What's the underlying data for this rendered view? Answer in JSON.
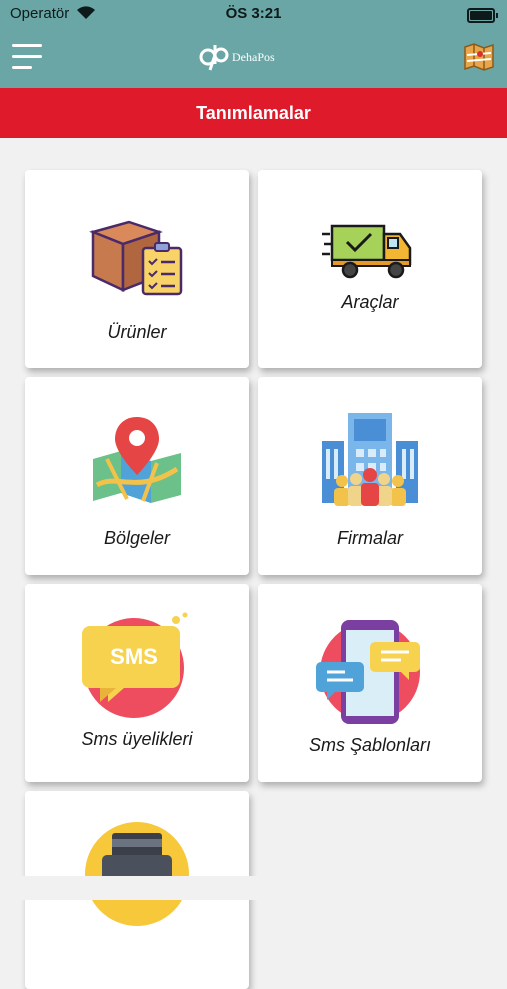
{
  "status": {
    "carrier": "Operatör",
    "time": "ÖS 3:21"
  },
  "header": {
    "brand": "DehaPos",
    "title": "Tanımlamalar"
  },
  "icons": {
    "menu": "hamburger-menu-icon",
    "map": "map-icon",
    "wifi": "wifi-icon",
    "battery": "battery-icon"
  },
  "colors": {
    "header": "#6aa6a6",
    "title_bar": "#df1a2a",
    "background": "#f1f1f1"
  },
  "tiles": [
    {
      "label": "Ürünler",
      "icon": "product-box-checklist-icon"
    },
    {
      "label": "Araçlar",
      "icon": "delivery-truck-icon"
    },
    {
      "label": "Bölgeler",
      "icon": "map-pin-icon"
    },
    {
      "label": "Firmalar",
      "icon": "company-building-icon"
    },
    {
      "label": "Sms üyelikleri",
      "icon": "sms-bubble-icon"
    },
    {
      "label": "Sms Şablonları",
      "icon": "sms-template-phone-icon"
    },
    {
      "label": "",
      "icon": "printer-icon"
    }
  ]
}
